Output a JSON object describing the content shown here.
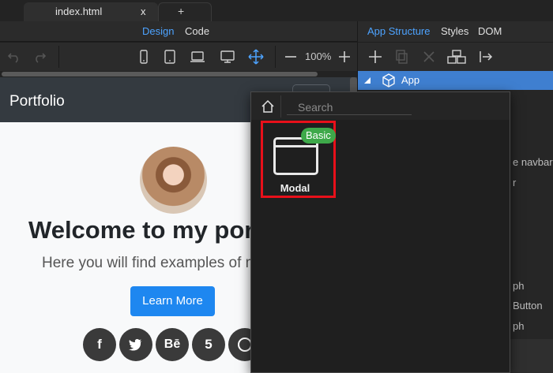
{
  "tabs": {
    "active": "index.html",
    "close": "x",
    "new": "+"
  },
  "view_toggle": {
    "design": "Design",
    "code": "Code"
  },
  "toolbar": {
    "zoom": "100%"
  },
  "preview": {
    "brand": "Portfolio",
    "heading": "Welcome to my por",
    "lead": "Here you will find examples of m",
    "button": "Learn More",
    "social": [
      "f",
      "",
      "Bē",
      "5",
      ""
    ]
  },
  "right_panel": {
    "tabs": [
      "App Structure",
      "Styles",
      "DOM"
    ],
    "root": "App",
    "fragments": [
      "e navbarN",
      "r",
      "ph",
      "Button",
      "ph"
    ]
  },
  "popup": {
    "search_placeholder": "Search",
    "item": {
      "label": "Modal",
      "badge": "Basic"
    }
  },
  "colors": {
    "accent": "#4da3ff",
    "selection": "#3f7fd0",
    "highlight": "#e8101a",
    "badge": "#3ea94a",
    "primary_button": "#1e87f0"
  }
}
